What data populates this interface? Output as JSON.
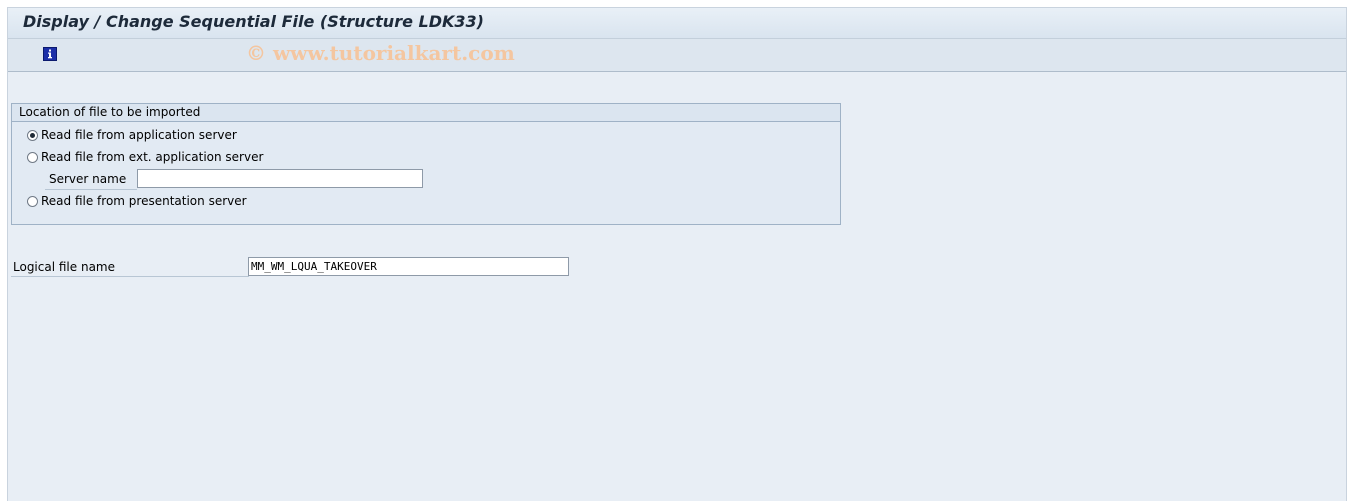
{
  "window": {
    "title": "Display / Change Sequential File (Structure LDK33)"
  },
  "toolbar": {
    "info_icon": "info-icon",
    "watermark": "© www.tutorialkart.com"
  },
  "location_group": {
    "title": "Location of file to be imported",
    "options": [
      {
        "label": "Read file from application server",
        "selected": true
      },
      {
        "label": "Read file from ext. application server",
        "selected": false
      },
      {
        "label": "Read file from presentation server",
        "selected": false
      }
    ],
    "server_name": {
      "label": "Server name",
      "value": ""
    }
  },
  "logical_file": {
    "label": "Logical file name",
    "value": "MM_WM_LQUA_TAKEOVER"
  }
}
